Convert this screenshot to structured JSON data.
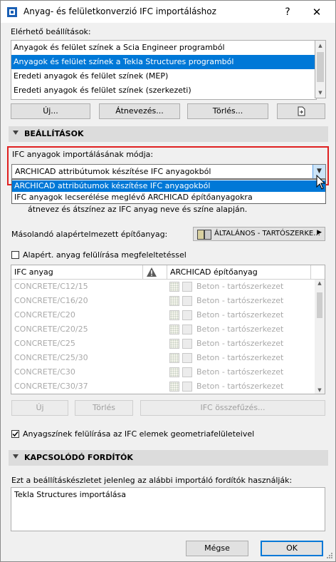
{
  "window": {
    "title": "Anyag- és felületkonverzió IFC importáláshoz",
    "help": "?",
    "close": "✕"
  },
  "presets": {
    "label": "Elérhető beállítások:",
    "items": [
      "Anyagok és felület színek a Scia Engineer programból",
      "Anyagok és felület színek a Tekla Structures programból",
      "Eredeti anyagok és felület színek (MEP)",
      "Eredeti anyagok és felület színek (szerkezeti)"
    ],
    "selected_index": 1,
    "buttons": {
      "new": "Új...",
      "rename": "Átnevezés...",
      "delete": "Törlés..."
    }
  },
  "settings": {
    "header": "BEÁLLÍTÁSOK",
    "mode_label": "IFC anyagok importálásának módja:",
    "mode_value": "ARCHICAD attribútumok készítése IFC anyagokból",
    "mode_options": [
      "ARCHICAD attribútumok készítése IFC anyagokból",
      "IFC anyagok lecserélése meglévő ARCHICAD építőanyagokra"
    ],
    "highlighted_option": 0,
    "partial_hint": "átnevez és átszínez az IFC anyag neve és színe alapján.",
    "default_material_label": "Másolandó alapértelmezett építőanyag:",
    "default_material_value": "ÁLTALÁNOS - TARTÓSZERKE...",
    "override_label": "Alapért. anyag felülírása megfeleltetéssel",
    "override_checked": false
  },
  "table": {
    "columns": {
      "ifc": "IFC anyag",
      "archicad": "ARCHICAD építőanyag"
    },
    "rows": [
      {
        "ifc": "CONCRETE/C12/15",
        "archicad": "Beton - tartószerkezet"
      },
      {
        "ifc": "CONCRETE/C16/20",
        "archicad": "Beton - tartószerkezet"
      },
      {
        "ifc": "CONCRETE/C20",
        "archicad": "Beton - tartószerkezet"
      },
      {
        "ifc": "CONCRETE/C20/25",
        "archicad": "Beton - tartószerkezet"
      },
      {
        "ifc": "CONCRETE/C25",
        "archicad": "Beton - tartószerkezet"
      },
      {
        "ifc": "CONCRETE/C25/30",
        "archicad": "Beton - tartószerkezet"
      },
      {
        "ifc": "CONCRETE/C30",
        "archicad": "Beton - tartószerkezet"
      },
      {
        "ifc": "CONCRETE/C30/37",
        "archicad": "Beton - tartószerkezet"
      }
    ],
    "buttons": {
      "new": "Új",
      "delete": "Törlés",
      "merge": "IFC összefűzés..."
    }
  },
  "surface_override": {
    "label": "Anyagszínek felülírása az IFC elemek geometriafelületeivel",
    "checked": true
  },
  "translators": {
    "header": "KAPCSOLÓDÓ FORDÍTÓK",
    "description": "Ezt a beállításkészletet jelenleg az alábbi importáló fordítók használják:",
    "items": [
      "Tekla Structures importálása"
    ]
  },
  "footer": {
    "cancel": "Mégse",
    "ok": "OK"
  },
  "colors": {
    "accent": "#0078d7",
    "highlight_border": "#e02020",
    "section_bg": "#dcdcdc"
  }
}
